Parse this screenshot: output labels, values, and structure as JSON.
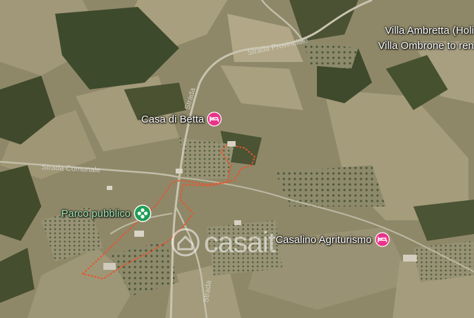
{
  "map": {
    "places": {
      "villa_1": {
        "name": "Villa Ambretta (Holi",
        "category": "hotel"
      },
      "villa_2": {
        "name": "Villa Ombrone to ren",
        "category": "hotel"
      },
      "casa": {
        "name": "Casa di Betta",
        "category": "hotel"
      },
      "parco": {
        "name": "Parco pubblico",
        "category": "park"
      },
      "casalino": {
        "name": "Casalino Agriturismo",
        "category": "hotel"
      }
    },
    "roads": {
      "strada_1": "Strada Provinciale",
      "strada_2": "Strada",
      "strada_3": "Strada Comunale",
      "strada_4": "Strada"
    },
    "watermark": "casait",
    "colors": {
      "hotel_pin": "#e8348a",
      "park_pin": "#1e9e55",
      "boundary": "#e6552e",
      "label": "#ffffff",
      "park_label": "#9fe7b4"
    }
  }
}
